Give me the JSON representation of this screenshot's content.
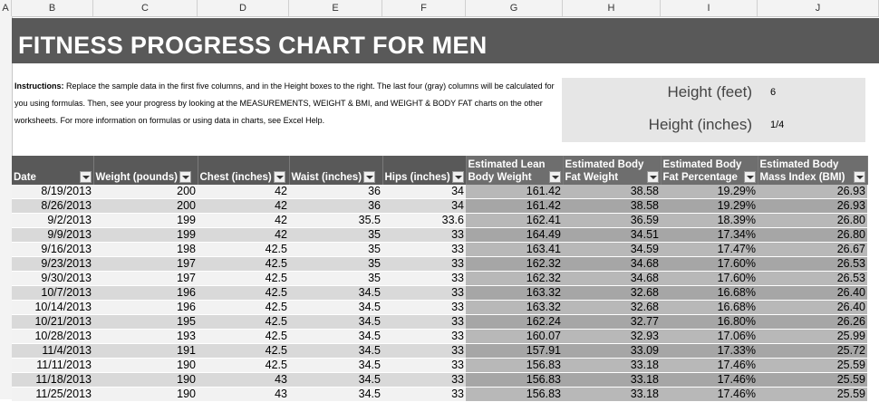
{
  "column_headers": [
    "A",
    "B",
    "C",
    "D",
    "E",
    "F",
    "G",
    "H",
    "I",
    "J"
  ],
  "title": "FITNESS PROGRESS CHART FOR MEN",
  "instructions": {
    "lead": "Instructions:",
    "body": " Replace the sample data in the first five columns, and in the Height boxes to the right. The last four (gray) columns will be calculated for you using formulas. Then, see your progress by looking at the MEASUREMENTS, WEIGHT & BMI, and WEIGHT & BODY FAT charts on the other worksheets. For more information on formulas or using data in charts, see Excel Help."
  },
  "height": {
    "feet_label": "Height (feet)",
    "feet_value": "6",
    "inches_label": "Height (inches)",
    "inches_value": "1/4"
  },
  "table": {
    "headers": [
      "Date",
      "Weight (pounds)",
      "Chest (inches)",
      "Waist (inches)",
      "Hips (inches)",
      "Estimated Lean Body Weight",
      "Estimated Body Fat Weight",
      "Estimated Body Fat Percentage",
      "Estimated Body Mass Index (BMI)"
    ],
    "rows": [
      [
        "8/19/2013",
        "200",
        "42",
        "36",
        "34",
        "161.42",
        "38.58",
        "19.29%",
        "26.93"
      ],
      [
        "8/26/2013",
        "200",
        "42",
        "36",
        "34",
        "161.42",
        "38.58",
        "19.29%",
        "26.93"
      ],
      [
        "9/2/2013",
        "199",
        "42",
        "35.5",
        "33.6",
        "162.41",
        "36.59",
        "18.39%",
        "26.80"
      ],
      [
        "9/9/2013",
        "199",
        "42",
        "35",
        "33",
        "164.49",
        "34.51",
        "17.34%",
        "26.80"
      ],
      [
        "9/16/2013",
        "198",
        "42.5",
        "35",
        "33",
        "163.41",
        "34.59",
        "17.47%",
        "26.67"
      ],
      [
        "9/23/2013",
        "197",
        "42.5",
        "35",
        "33",
        "162.32",
        "34.68",
        "17.60%",
        "26.53"
      ],
      [
        "9/30/2013",
        "197",
        "42.5",
        "35",
        "33",
        "162.32",
        "34.68",
        "17.60%",
        "26.53"
      ],
      [
        "10/7/2013",
        "196",
        "42.5",
        "34.5",
        "33",
        "163.32",
        "32.68",
        "16.68%",
        "26.40"
      ],
      [
        "10/14/2013",
        "196",
        "42.5",
        "34.5",
        "33",
        "163.32",
        "32.68",
        "16.68%",
        "26.40"
      ],
      [
        "10/21/2013",
        "195",
        "42.5",
        "34.5",
        "33",
        "162.24",
        "32.77",
        "16.80%",
        "26.26"
      ],
      [
        "10/28/2013",
        "193",
        "42.5",
        "34.5",
        "33",
        "160.07",
        "32.93",
        "17.06%",
        "25.99"
      ],
      [
        "11/4/2013",
        "191",
        "42.5",
        "34.5",
        "33",
        "157.91",
        "33.09",
        "17.33%",
        "25.72"
      ],
      [
        "11/11/2013",
        "190",
        "42.5",
        "34.5",
        "33",
        "156.83",
        "33.18",
        "17.46%",
        "25.59"
      ],
      [
        "11/18/2013",
        "190",
        "43",
        "34.5",
        "33",
        "156.83",
        "33.18",
        "17.46%",
        "25.59"
      ],
      [
        "11/25/2013",
        "190",
        "43",
        "34.5",
        "33",
        "156.83",
        "33.18",
        "17.46%",
        "25.59"
      ]
    ]
  }
}
